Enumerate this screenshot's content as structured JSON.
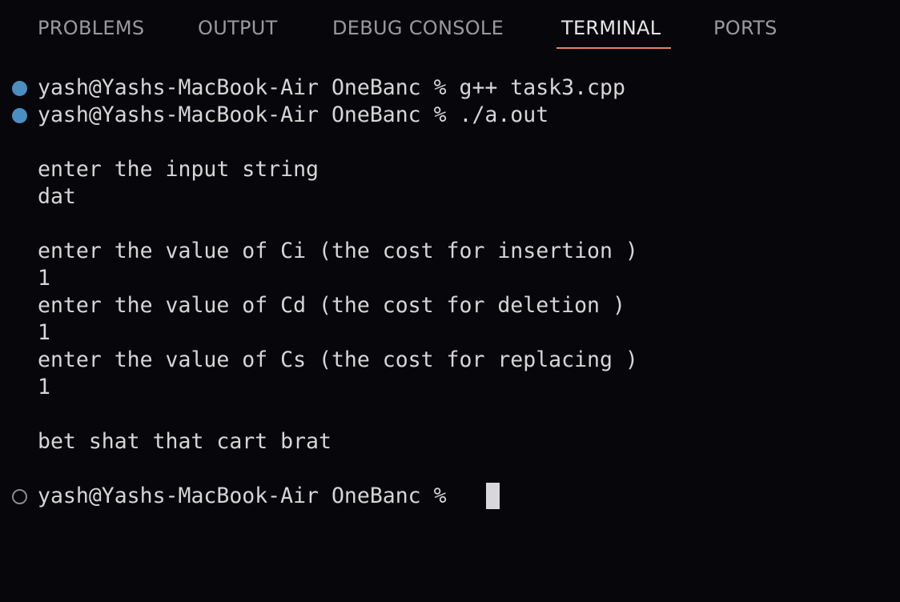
{
  "panel_tabs": [
    {
      "label": "PROBLEMS"
    },
    {
      "label": "OUTPUT"
    },
    {
      "label": "DEBUG CONSOLE"
    },
    {
      "label": "TERMINAL",
      "active": true
    },
    {
      "label": "PORTS"
    }
  ],
  "terminal": {
    "prompt": "yash@Yashs-MacBook-Air OneBanc %",
    "commands": [
      {
        "text": "yash@Yashs-MacBook-Air OneBanc % g++ task3.cpp",
        "status": "success"
      },
      {
        "text": "yash@Yashs-MacBook-Air OneBanc % ./a.out",
        "status": "success"
      }
    ],
    "output": [
      "enter the input string",
      "dat",
      "enter the value of Ci (the cost for insertion )",
      "1",
      "enter the value of Cd (the cost for deletion )",
      "1",
      "enter the value of Cs (the cost for replacing )",
      "1",
      "bet shat that cart brat"
    ],
    "current_prompt": "yash@Yashs-MacBook-Air OneBanc %"
  },
  "colors": {
    "background": "#07060b",
    "text": "#d6d6d6",
    "tab_inactive": "#9a9a9e",
    "tab_active": "#e6e6e6",
    "active_underline": "#e8836c",
    "success_dot": "#4a8fc0",
    "pending_dot": "#8a8a8e",
    "cursor": "#d8d8dc"
  }
}
